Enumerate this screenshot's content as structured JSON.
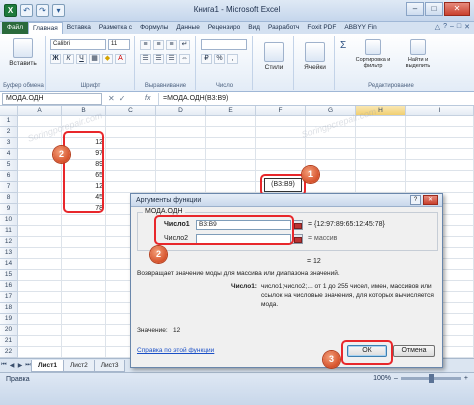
{
  "window": {
    "title": "Книга1 - Microsoft Excel",
    "controls": [
      "–",
      "□",
      "✕"
    ]
  },
  "quick_access": [
    "X",
    "↶",
    "↷",
    "▾"
  ],
  "ribbon_tabs": [
    "Файл",
    "Главная",
    "Вставка",
    "Разметка с",
    "Формулы",
    "Данные",
    "Рецензиро",
    "Вид",
    "Разработч",
    "Foxit PDF",
    "ABBYY Fin"
  ],
  "active_tab": "Главная",
  "help_icons": [
    "△",
    "?",
    "–",
    "□",
    "✕"
  ],
  "ribbon": {
    "groups": [
      {
        "label": "Буфер обмена",
        "big": "Вставить"
      },
      {
        "label": "Шрифт",
        "font": "Calibri",
        "size": "11"
      },
      {
        "label": "Выравнивание"
      },
      {
        "label": "Число",
        "format": "%"
      },
      {
        "label": "",
        "big": "Стили"
      },
      {
        "label": "",
        "big": "Ячейки"
      },
      {
        "label": "Редактирование",
        "sigma": "Σ",
        "sort": "Сортировка и фильтр",
        "find": "Найти и выделить"
      }
    ],
    "font_buttons": [
      "Ж",
      "К",
      "Ч"
    ]
  },
  "formula_bar": {
    "name_box": "МОДА.ОДН",
    "fx": "fx",
    "buttons": [
      "✕",
      "✓"
    ],
    "formula": "=МОДА.ОДН(B3:B9)"
  },
  "columns": [
    "A",
    "B",
    "C",
    "D",
    "E",
    "F",
    "G",
    "H",
    "I"
  ],
  "selected_column": "H",
  "rows": [
    {
      "n": "1",
      "b": ""
    },
    {
      "n": "2",
      "b": ""
    },
    {
      "n": "3",
      "b": "12"
    },
    {
      "n": "4",
      "b": "97"
    },
    {
      "n": "5",
      "b": "89"
    },
    {
      "n": "6",
      "b": "65"
    },
    {
      "n": "7",
      "b": "12"
    },
    {
      "n": "8",
      "b": "45"
    },
    {
      "n": "9",
      "b": "78"
    },
    {
      "n": "10",
      "b": ""
    },
    {
      "n": "11",
      "b": ""
    },
    {
      "n": "12",
      "b": ""
    },
    {
      "n": "13",
      "b": ""
    },
    {
      "n": "14",
      "b": ""
    },
    {
      "n": "15",
      "b": ""
    },
    {
      "n": "16",
      "b": ""
    },
    {
      "n": "17",
      "b": ""
    },
    {
      "n": "18",
      "b": ""
    },
    {
      "n": "19",
      "b": ""
    },
    {
      "n": "20",
      "b": ""
    },
    {
      "n": "21",
      "b": ""
    },
    {
      "n": "22",
      "b": ""
    }
  ],
  "cell_tooltip": "(B3:B9)",
  "sheets": [
    "Лист1",
    "Лист2",
    "Лист3"
  ],
  "active_sheet": "Лист1",
  "status": {
    "text": "Правка",
    "zoom": "100%"
  },
  "dialog": {
    "title": "Аргументы функции",
    "function_name": "МОДА.ОДН",
    "arg1_label": "Число1",
    "arg1_value": "B3:B9",
    "arg1_result": "= {12:97:89:65:12:45:78}",
    "arg2_label": "Число2",
    "arg2_value": "",
    "arg2_result": "= массив",
    "total_result": "= 12",
    "description": "Возвращает значение моды для массива или диапазона значений.",
    "arg_help_label": "Число1:",
    "arg_help_text": "число1;число2;... от 1 до 255 чисел, имен, массивов или ссылок на числовые значения, для которых вычисляется мода.",
    "value_label": "Значение:",
    "value": "12",
    "help_link": "Справка по этой функции",
    "ok": "ОК",
    "cancel": "Отмена",
    "title_buttons": [
      "?",
      "✕"
    ]
  },
  "markers": [
    "1",
    "2",
    "2",
    "3"
  ],
  "watermark": "Soringpcrepair.com",
  "colors": {
    "accent_red": "#e8272b",
    "marker_orange": "#d6522b",
    "file_tab": "#2a6a3b"
  }
}
